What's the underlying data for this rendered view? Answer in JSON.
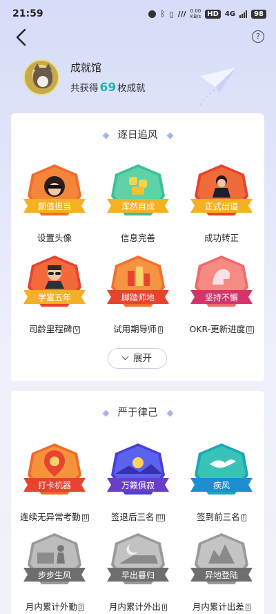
{
  "status_bar": {
    "time": "21:59",
    "net_speed_value": "0.00",
    "net_speed_unit": "KB/s",
    "hd": "HD",
    "network": "4G",
    "battery": "98"
  },
  "header": {
    "help_label": "?"
  },
  "profile": {
    "name": "成就馆",
    "count_prefix": "共获得",
    "count": "69",
    "count_suffix": "枚成就"
  },
  "sections": [
    {
      "title": "逐日追风",
      "expand_label": "展开",
      "badges": [
        {
          "ribbon": "颜值担当",
          "label": "设置头像",
          "level": ""
        },
        {
          "ribbon": "浑然自成",
          "label": "信息完善",
          "level": ""
        },
        {
          "ribbon": "正式出道",
          "label": "成功转正",
          "level": ""
        },
        {
          "ribbon": "学富五年",
          "label": "司龄里程碑",
          "level": "V"
        },
        {
          "ribbon": "脚踏师地",
          "label": "试用期导师",
          "level": "I"
        },
        {
          "ribbon": "坚持不懈",
          "label": "OKR-更新进度",
          "level": "II"
        }
      ]
    },
    {
      "title": "严于律己",
      "badges": [
        {
          "ribbon": "打卡机器",
          "label": "连续无异常考勤",
          "level": "II"
        },
        {
          "ribbon": "万籁俱寂",
          "label": "签退后三名",
          "level": "III"
        },
        {
          "ribbon": "疾风",
          "label": "签到前三名",
          "level": "I"
        },
        {
          "ribbon": "步步生风",
          "label": "月内累计外勤",
          "level": "I"
        },
        {
          "ribbon": "早出暮归",
          "label": "月内累计外出",
          "level": "I"
        },
        {
          "ribbon": "异地登陆",
          "label": "月内累计出差",
          "level": "I"
        }
      ]
    }
  ],
  "colors": {
    "accent_count": "#20b7a8",
    "ribbon_orange": "#f39a1e",
    "ribbon_red": "#e8432e",
    "ribbon_purple": "#6a3fc8",
    "ribbon_teal": "#1aa6b8",
    "ribbon_gray": "#6e6e6e"
  }
}
